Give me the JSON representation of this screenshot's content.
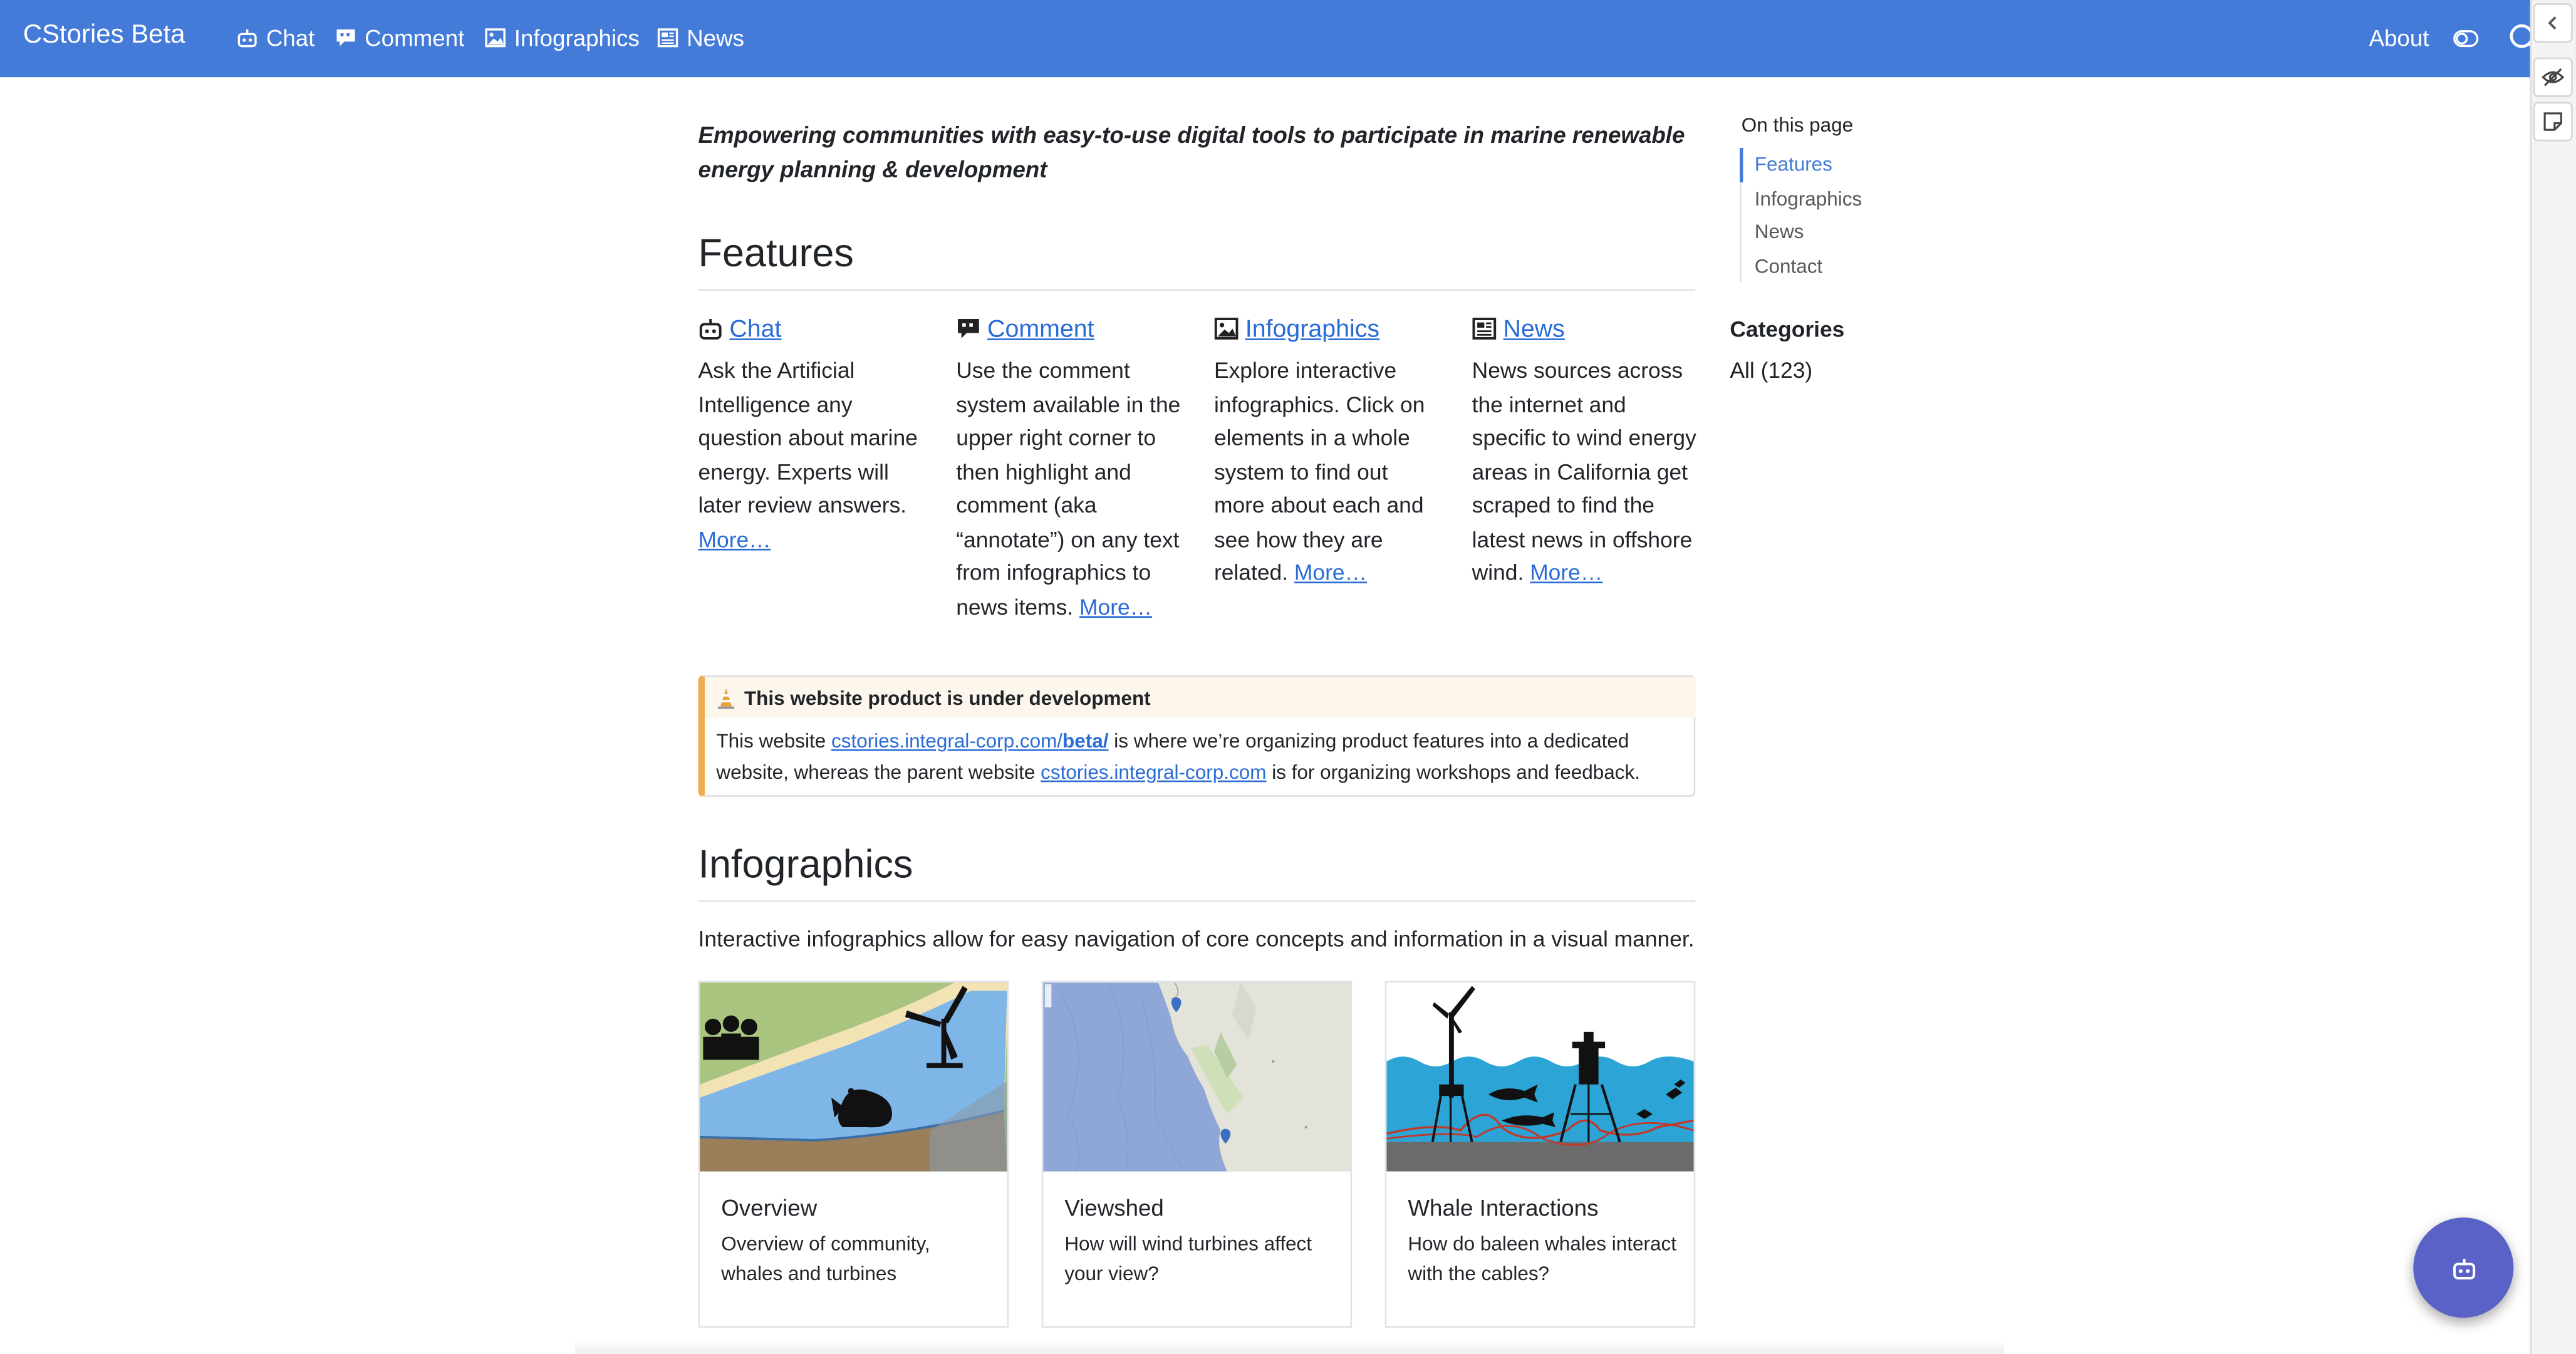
{
  "header": {
    "brand": "CStories Beta",
    "nav": [
      {
        "label": "Chat",
        "icon": "robot-icon"
      },
      {
        "label": "Comment",
        "icon": "comment-icon"
      },
      {
        "label": "Infographics",
        "icon": "image-icon"
      },
      {
        "label": "News",
        "icon": "newspaper-icon"
      }
    ],
    "about_label": "About",
    "accent_color": "#447BD9"
  },
  "main": {
    "lead": "Empowering communities with easy-to-use digital tools to participate in marine renewable energy planning & development",
    "features_heading": "Features",
    "features": [
      {
        "title": "Chat",
        "icon": "robot-icon",
        "text": "Ask the Artificial Intelligence any question about marine energy. Experts will later review answers.",
        "more": "More…"
      },
      {
        "title": "Comment",
        "icon": "comment-icon",
        "text": "Use the comment system available in the upper right corner to then highlight and comment (aka “annotate”) on any text from infographics to news items.",
        "more": "More…"
      },
      {
        "title": "Infographics",
        "icon": "image-icon",
        "text": "Explore interactive infographics. Click on elements in a whole system to find out more about each and see how they are related.",
        "more": "More…"
      },
      {
        "title": "News",
        "icon": "newspaper-icon",
        "text": "News sources across the internet and specific to wind energy areas in California get scraped to find the latest news in offshore wind.",
        "more": "More…"
      }
    ],
    "callout": {
      "title": "This website product is under development",
      "text_1": "This website ",
      "link_1_prefix": "cstories.integral-corp.com/",
      "link_1_bold": "beta/",
      "text_2": " is where we’re organizing product features into a dedicated website, whereas the parent website ",
      "link_2": "cstories.integral-corp.com",
      "text_3": " is for organizing workshops and feedback.",
      "accent_color": "#f0ad4e"
    },
    "infographics_heading": "Infographics",
    "infographics_intro": "Interactive infographics allow for easy navigation of core concepts and information in a visual manner.",
    "cards": [
      {
        "title": "Overview",
        "text": "Overview of community, whales and turbines"
      },
      {
        "title": "Viewshed",
        "text": "How will wind turbines affect your view?"
      },
      {
        "title": "Whale Interactions",
        "text": "How do baleen whales interact with the cables?"
      }
    ]
  },
  "toc": {
    "heading": "On this page",
    "items": [
      {
        "label": "Features",
        "active": true
      },
      {
        "label": "Infographics",
        "active": false
      },
      {
        "label": "News",
        "active": false
      },
      {
        "label": "Contact",
        "active": false
      }
    ]
  },
  "categories": {
    "heading": "Categories",
    "all": "All (123)"
  }
}
